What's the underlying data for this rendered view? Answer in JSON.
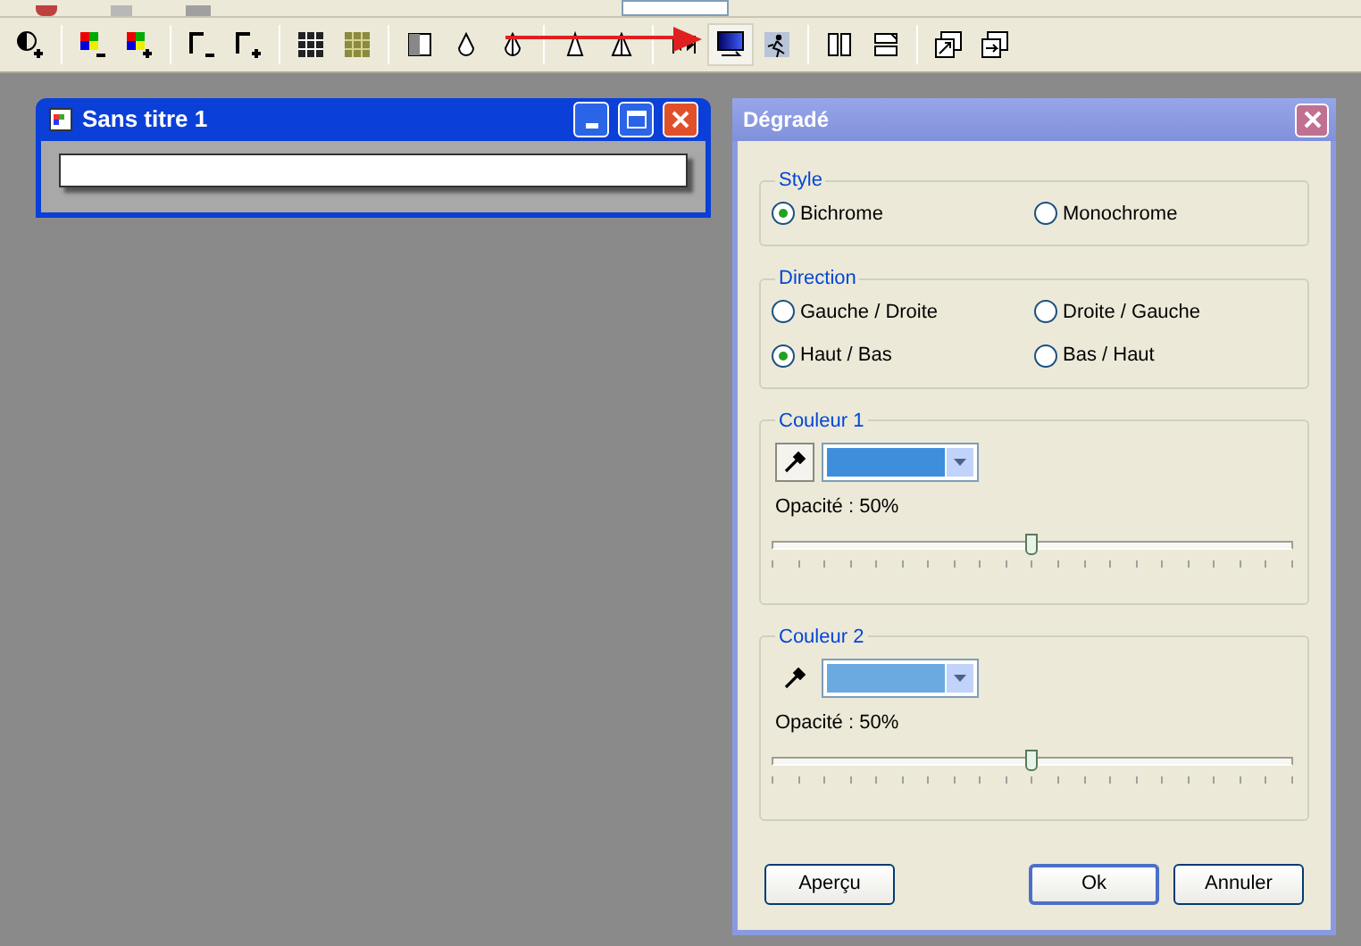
{
  "document_window": {
    "title": "Sans titre 1"
  },
  "dialog": {
    "title": "Dégradé",
    "groups": [
      {
        "kind": "radio",
        "label": "Style",
        "options": [
          {
            "label": "Bichrome",
            "selected": true
          },
          {
            "label": "Monochrome",
            "selected": false
          }
        ]
      },
      {
        "kind": "radio",
        "label": "Direction",
        "options": [
          {
            "label": "Gauche / Droite",
            "selected": false
          },
          {
            "label": "Droite / Gauche",
            "selected": false
          },
          {
            "label": "Haut / Bas",
            "selected": true
          },
          {
            "label": "Bas / Haut",
            "selected": false
          }
        ]
      },
      {
        "kind": "color",
        "label": "Couleur 1",
        "color": "#3f8edc",
        "picker_pressed": true,
        "opacity_label": "Opacité : 50%",
        "level": 0.5
      },
      {
        "kind": "color",
        "label": "Couleur 2",
        "color": "#6aaae0",
        "picker_pressed": false,
        "opacity_label": "Opacité : 50%",
        "level": 0.5
      }
    ],
    "buttons": [
      {
        "label": "Aperçu",
        "default": false
      },
      {
        "label": "Ok",
        "default": true
      },
      {
        "label": "Annuler",
        "default": false
      }
    ]
  }
}
